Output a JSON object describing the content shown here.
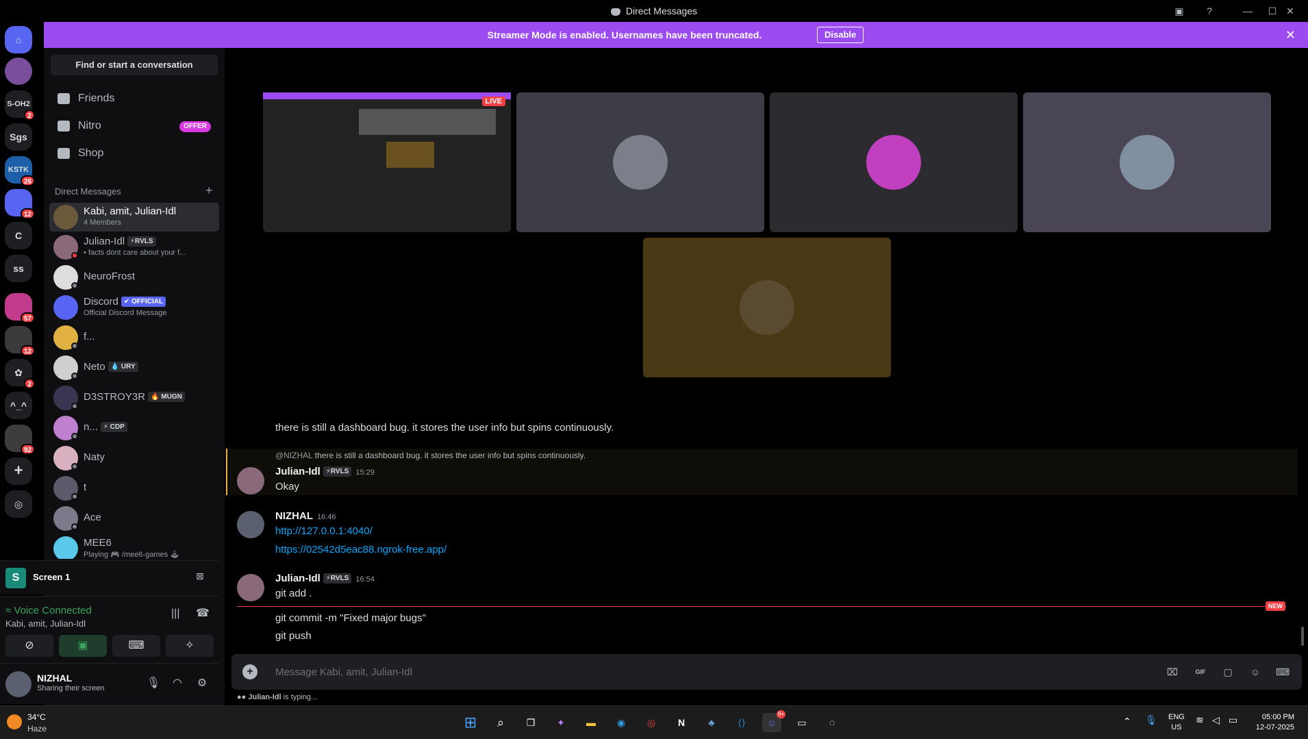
{
  "window": {
    "title": "Direct Messages"
  },
  "banner": {
    "text": "Streamer Mode is enabled. Usernames have been truncated.",
    "button": "Disable"
  },
  "servers": [
    {
      "label": "",
      "badge": ""
    },
    {
      "label": "",
      "badge": ""
    },
    {
      "label": "S-OH2",
      "badge": "2"
    },
    {
      "label": "Sgs",
      "badge": ""
    },
    {
      "label": "KSTK",
      "badge": "26"
    },
    {
      "label": "",
      "badge": "12"
    },
    {
      "label": "C",
      "badge": ""
    },
    {
      "label": "ss",
      "badge": ""
    },
    {
      "label": "",
      "badge": "57"
    },
    {
      "label": "",
      "badge": "12"
    },
    {
      "label": "",
      "badge": "2"
    },
    {
      "label": "^_^",
      "badge": ""
    },
    {
      "label": "",
      "badge": "92"
    }
  ],
  "sidebar": {
    "search": "Find or start a conversation",
    "nav": [
      {
        "label": "Friends"
      },
      {
        "label": "Nitro",
        "badge": "OFFER"
      },
      {
        "label": "Shop"
      }
    ],
    "dm_header": "Direct Messages",
    "dms": [
      {
        "name": "Kabi, amit, Julian-Idl",
        "sub": "4 Members",
        "tag": ""
      },
      {
        "name": "Julian-Idl",
        "tag": "⚡RVLS",
        "sub": "• facts dont care about your f..."
      },
      {
        "name": "NeuroFrost",
        "tag": "",
        "sub": ""
      },
      {
        "name": "Discord",
        "tag": "✔ OFFICIAL",
        "sub": "Official Discord Message"
      },
      {
        "name": "f...",
        "tag": "",
        "sub": ""
      },
      {
        "name": "Neto",
        "tag": "💧 URY",
        "sub": ""
      },
      {
        "name": "D3STROY3R",
        "tag": "🔥 MUGN",
        "sub": ""
      },
      {
        "name": "n...",
        "tag": "⚡ CDP",
        "sub": ""
      },
      {
        "name": "Naty",
        "tag": "",
        "sub": ""
      },
      {
        "name": "t",
        "tag": "",
        "sub": ""
      },
      {
        "name": "Ace",
        "tag": "",
        "sub": ""
      },
      {
        "name": "MEE6",
        "tag": "",
        "sub": "Playing 🎮 /mee6-games 🕹"
      }
    ]
  },
  "screen": {
    "label": "Screen 1"
  },
  "voice": {
    "status": "Voice Connected",
    "channel": "Kabi, amit, Julian-Idl"
  },
  "user": {
    "name": "NIZHAL",
    "status": "Sharing their screen"
  },
  "stream": {
    "live": "LIVE"
  },
  "messages": {
    "first": "there is still a dashboard bug. it stores the user info but spins continuously.",
    "reply_to": "@NIZHAL",
    "reply_text": "there is still a dashboard bug. it stores the user info but spins continuously.",
    "m1": {
      "author": "Julian-Idl",
      "tag": "⚡RVLS",
      "time": "15:29",
      "text": "Okay"
    },
    "m2": {
      "author": "NIZHAL",
      "time": "16:46",
      "link1": "http://127.0.0.1:4040/",
      "link2": "https://02542d5eac88.ngrok-free.app/"
    },
    "m3": {
      "author": "Julian-Idl",
      "tag": "⚡RVLS",
      "time": "16:54",
      "text": "git add ."
    },
    "new_label": "NEW",
    "m4": "git commit -m \"Fixed major bugs\"",
    "m5": "git push"
  },
  "composer": {
    "placeholder": "Message Kabi, amit, Julian-Idl",
    "gif": "GIF"
  },
  "typing": {
    "name": "Julian-Idl",
    "text": " is typing..."
  },
  "taskbar": {
    "weather_temp": "34°C",
    "weather_desc": "Haze",
    "lang1": "ENG",
    "lang2": "US",
    "time": "05:00 PM",
    "date": "12-07-2025",
    "discord_badge": "9+"
  }
}
